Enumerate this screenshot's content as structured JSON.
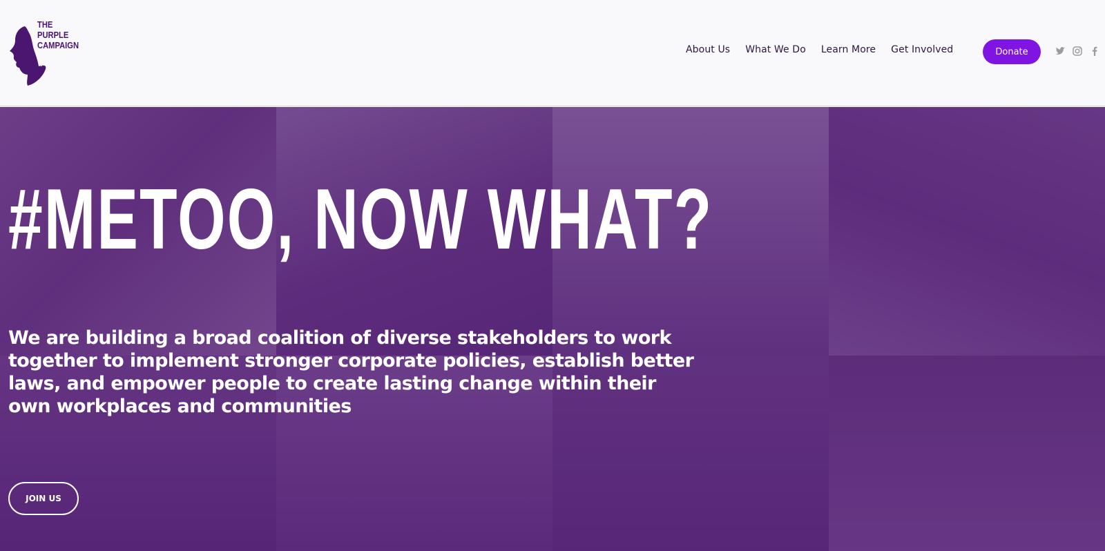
{
  "brand": {
    "name_lines": [
      "THE",
      "PURPLE",
      "CAMPAIGN"
    ],
    "color": "#4a1670"
  },
  "nav": {
    "items": [
      "About Us",
      "What We Do",
      "Learn More",
      "Get Involved"
    ],
    "donate_label": "Donate",
    "donate_color": "#8014e3",
    "social_icons": [
      "twitter-icon",
      "instagram-icon",
      "facebook-icon"
    ]
  },
  "hero": {
    "headline": "#METOO, NOW WHAT?",
    "subtext": "We are building a broad coalition of diverse stakeholders to work together to implement stronger corporate policies, establish better laws, and empower people to create lasting change within their own workplaces and communities",
    "cta_label": "JOIN US",
    "overlay_color": "#602684"
  }
}
